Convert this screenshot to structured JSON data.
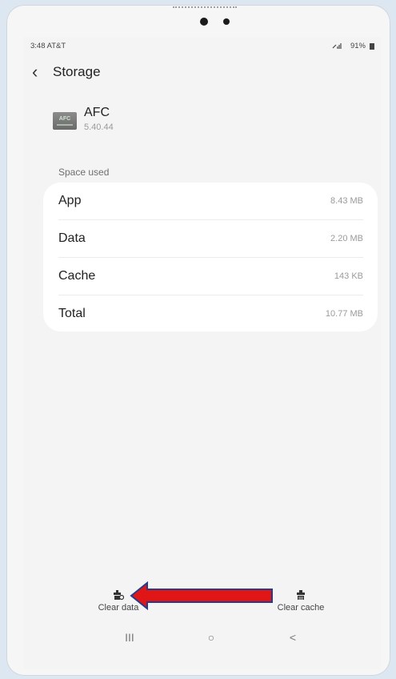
{
  "status_bar": {
    "time_carrier": "3:48 AT&T",
    "battery": "91%"
  },
  "header": {
    "title": "Storage"
  },
  "app": {
    "name": "AFC",
    "version": "5.40.44",
    "icon_text": "AFC"
  },
  "storage": {
    "section_label": "Space used",
    "rows": [
      {
        "label": "App",
        "value": "8.43 MB"
      },
      {
        "label": "Data",
        "value": "2.20 MB"
      },
      {
        "label": "Cache",
        "value": "143 KB"
      },
      {
        "label": "Total",
        "value": "10.77 MB"
      }
    ]
  },
  "actions": {
    "clear_data": "Clear data",
    "clear_cache": "Clear cache"
  },
  "nav": {
    "recents": "III",
    "home": "○",
    "back": "<"
  },
  "colors": {
    "arrow_fill": "#e01515",
    "arrow_stroke": "#2a3a8a",
    "card": "#ffffff"
  },
  "icons": [
    "back-icon",
    "signal-icon",
    "battery-icon",
    "clear-data-icon",
    "clear-cache-icon"
  ]
}
